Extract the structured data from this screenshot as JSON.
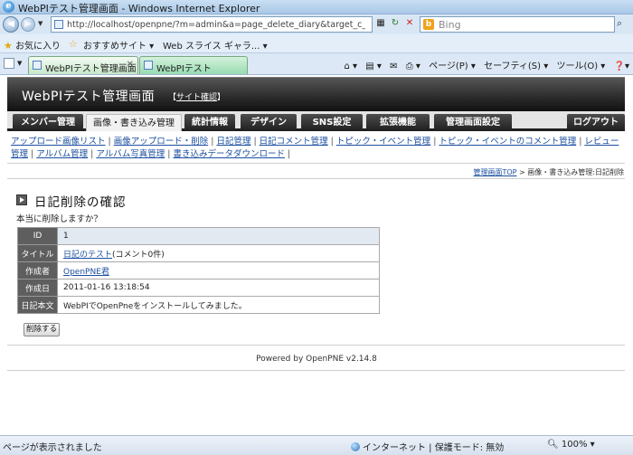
{
  "browser": {
    "title": "WebPIテスト管理画面 - Windows Internet Explorer",
    "url": "http://localhost/openpne/?m=admin&a=page_delete_diary&target_c_diary_id=",
    "search_placeholder": "Bing",
    "favorites_label": "お気に入り",
    "fav_items": [
      "おすすめサイト ▾",
      "Web スライス ギャラ... ▾"
    ],
    "tabs": [
      {
        "label": "WebPIテスト管理画面"
      },
      {
        "label": "WebPIテスト"
      }
    ],
    "commands": [
      "ページ(P) ▾",
      "セーフティ(S) ▾",
      "ツール(O) ▾"
    ],
    "status_text": "ページが表示されました",
    "zone_text": "インターネット | 保護モード: 無効",
    "zoom": "100%",
    "icon_names": [
      "ie-logo-icon",
      "back-arrow-icon",
      "forward-arrow-icon",
      "refresh-icon",
      "stop-icon",
      "bing-icon",
      "star-icon",
      "home-icon",
      "feeds-icon",
      "mail-icon",
      "print-icon",
      "help-icon",
      "globe-icon"
    ]
  },
  "header": {
    "title": "WebPIテスト管理画面",
    "link_prefix": "【",
    "link_label": "サイト確認",
    "link_suffix": "】"
  },
  "nav": {
    "tabs": [
      {
        "label": "メンバー管理"
      },
      {
        "label": "画像・書き込み管理"
      },
      {
        "label": "統計情報"
      },
      {
        "label": "デザイン"
      },
      {
        "label": "SNS設定"
      },
      {
        "label": "拡張機能"
      },
      {
        "label": "管理画面設定"
      },
      {
        "label": "ログアウト"
      }
    ],
    "active_index": 1
  },
  "subnav": {
    "links": [
      "アップロード画像リスト",
      "画像アップロード・削除",
      "日記管理",
      "日記コメント管理",
      "トピック・イベント管理",
      "トピック・イベントのコメント管理",
      "レビュー管理",
      "アルバム管理",
      "アルバム写真管理",
      "書き込みデータダウンロード"
    ]
  },
  "breadcrumb": {
    "home": "管理画面TOP",
    "rest": " > 画像・書き込み管理:日記削除"
  },
  "page": {
    "heading": "日記削除の確認",
    "confirm": "本当に削除しますか？",
    "delete_button": "削除する",
    "powered": "Powered by OpenPNE v2.14.8"
  },
  "detail": {
    "id_label": "ID",
    "id_value": "1",
    "title_label": "タイトル",
    "title_link": "日記のテスト",
    "title_comment": "(コメント0件)",
    "author_label": "作成者",
    "author_link": "OpenPNE君",
    "date_label": "作成日",
    "date_value": "2011-01-16 13:18:54",
    "body_label": "日記本文",
    "body_value": "WebPIでOpenPneをインストールしてみました。"
  },
  "colors": {
    "header_bg": "#2a2a2a",
    "nav_bg": "#1f1f1f",
    "link": "#1b4fa0",
    "th_bg": "#5e5e5e",
    "first_row_bg": "#e3e9f1"
  }
}
